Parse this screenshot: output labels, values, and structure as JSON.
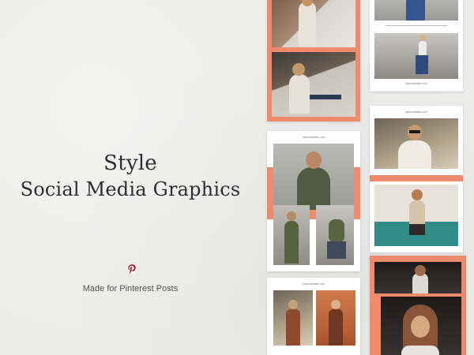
{
  "hero": {
    "title_line1": "Style",
    "title_line2": "Social Media Graphics",
    "platform_icon": "pinterest-icon",
    "subtitle": "Made for Pinterest Posts"
  },
  "colors": {
    "background": "#ececea",
    "accent": "#f08a6c",
    "pinterest_red": "#bd081c"
  },
  "cards": {
    "site_label": "www.website.com"
  }
}
